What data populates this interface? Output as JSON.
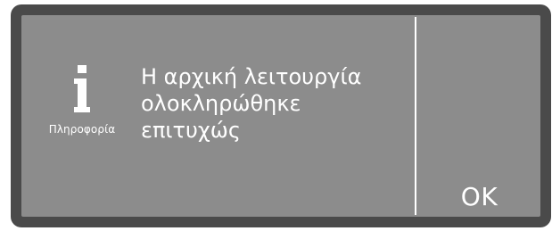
{
  "dialog": {
    "icon": "info-icon",
    "icon_label": "Πληροφορία",
    "message_lines": [
      "Η αρχική λειτουργία",
      "ολοκληρώθηκε",
      "επιτυχώς"
    ],
    "ok_label": "OK"
  },
  "colors": {
    "frame": "#4a4a4a",
    "screen": "#8c8c8c",
    "foreground": "#ffffff"
  }
}
